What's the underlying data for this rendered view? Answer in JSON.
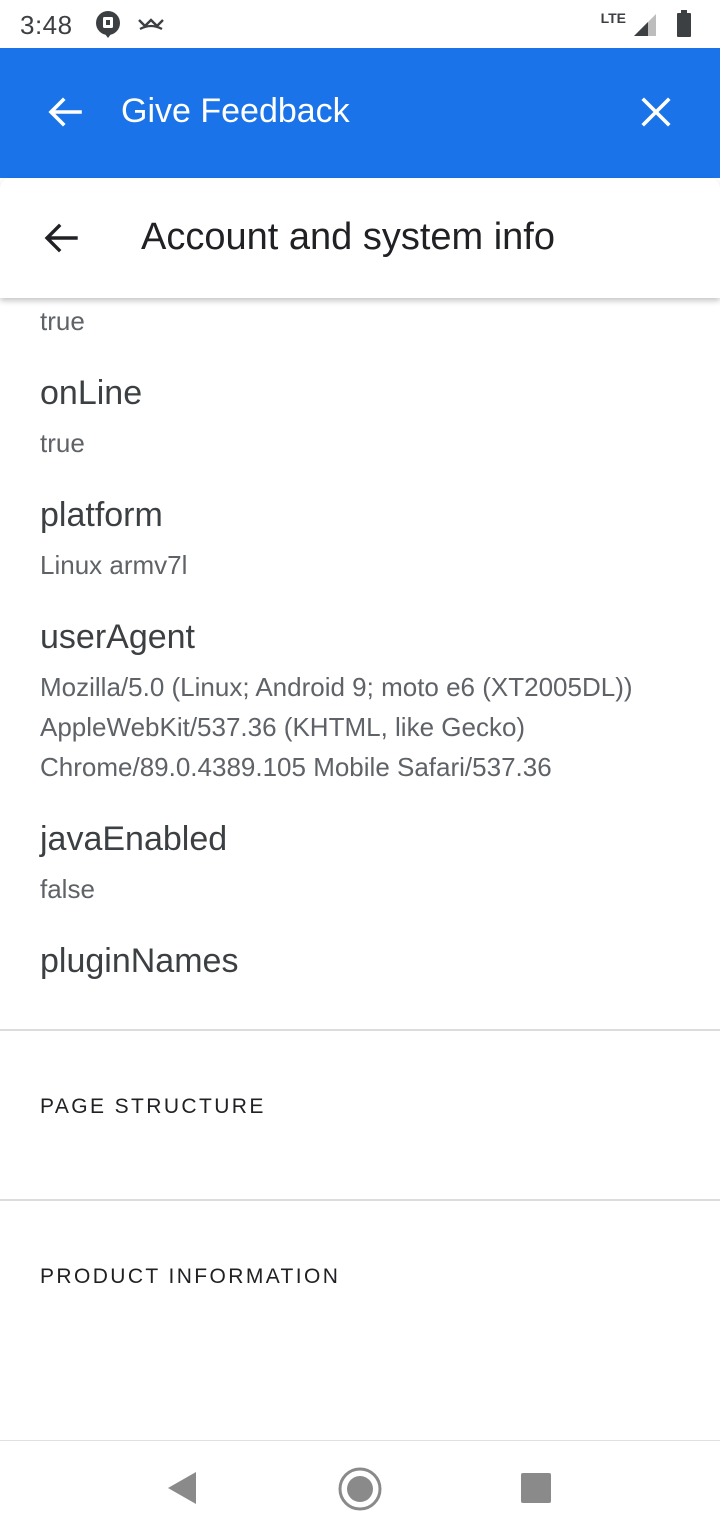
{
  "status_bar": {
    "time": "3:48",
    "network": "LTE",
    "icons": [
      "notification-icon",
      "missed-call-icon",
      "signal-icon",
      "battery-icon"
    ]
  },
  "app_bar": {
    "title": "Give Feedback",
    "back_icon": "arrow-back-icon",
    "close_icon": "close-icon",
    "color": "#1a73e8"
  },
  "sub_header": {
    "title": "Account and system info",
    "back_icon": "arrow-back-icon"
  },
  "properties": [
    {
      "name": "",
      "value": "true"
    },
    {
      "name": "onLine",
      "value": "true"
    },
    {
      "name": "platform",
      "value": "Linux armv7l"
    },
    {
      "name": "userAgent",
      "value_lines": [
        "Mozilla/5.0 (Linux; Android 9; moto e6 (XT2005DL))",
        "AppleWebKit/537.36 (KHTML, like Gecko)",
        "Chrome/89.0.4389.105 Mobile Safari/537.36"
      ]
    },
    {
      "name": "javaEnabled",
      "value": "false"
    },
    {
      "name": "pluginNames",
      "value": ""
    }
  ],
  "sections": [
    {
      "heading": "PAGE STRUCTURE"
    },
    {
      "heading": "PRODUCT INFORMATION"
    }
  ],
  "nav_bar": {
    "buttons": [
      "back-triangle-icon",
      "home-circle-icon",
      "recents-square-icon"
    ]
  }
}
